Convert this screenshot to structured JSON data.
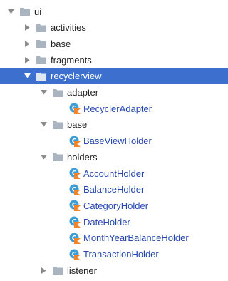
{
  "tree": {
    "items": [
      {
        "name": "ui",
        "kind": "folder",
        "expanded": true,
        "depth": 0,
        "selected": false
      },
      {
        "name": "activities",
        "kind": "folder",
        "expanded": false,
        "depth": 1,
        "selected": false
      },
      {
        "name": "base",
        "kind": "folder",
        "expanded": false,
        "depth": 1,
        "selected": false
      },
      {
        "name": "fragments",
        "kind": "folder",
        "expanded": false,
        "depth": 1,
        "selected": false
      },
      {
        "name": "recyclerview",
        "kind": "folder",
        "expanded": true,
        "depth": 1,
        "selected": true
      },
      {
        "name": "adapter",
        "kind": "folder",
        "expanded": true,
        "depth": 2,
        "selected": false
      },
      {
        "name": "RecyclerAdapter",
        "kind": "class",
        "depth": 3,
        "selected": false
      },
      {
        "name": "base",
        "kind": "folder",
        "expanded": true,
        "depth": 2,
        "selected": false
      },
      {
        "name": "BaseViewHolder",
        "kind": "class",
        "depth": 3,
        "selected": false
      },
      {
        "name": "holders",
        "kind": "folder",
        "expanded": true,
        "depth": 2,
        "selected": false
      },
      {
        "name": "AccountHolder",
        "kind": "class",
        "depth": 3,
        "selected": false
      },
      {
        "name": "BalanceHolder",
        "kind": "class",
        "depth": 3,
        "selected": false
      },
      {
        "name": "CategoryHolder",
        "kind": "class",
        "depth": 3,
        "selected": false
      },
      {
        "name": "DateHolder",
        "kind": "class",
        "depth": 3,
        "selected": false
      },
      {
        "name": "MonthYearBalanceHolder",
        "kind": "class",
        "depth": 3,
        "selected": false
      },
      {
        "name": "TransactionHolder",
        "kind": "class",
        "depth": 3,
        "selected": false
      },
      {
        "name": "listener",
        "kind": "folder",
        "expanded": false,
        "depth": 2,
        "selected": false
      }
    ]
  },
  "colors": {
    "selection": "#3d6fcf",
    "folder": "#a9b4bf",
    "class_label": "#2448b0",
    "kotlin_circle": "#3f9dd6",
    "kotlin_badge": "#f0852b",
    "arrow": "#8b8b8b"
  },
  "icons": {
    "folder": "folder-icon",
    "kotlin_class": "kotlin-class-icon",
    "expanded": "chevron-down-icon",
    "collapsed": "chevron-right-icon"
  }
}
